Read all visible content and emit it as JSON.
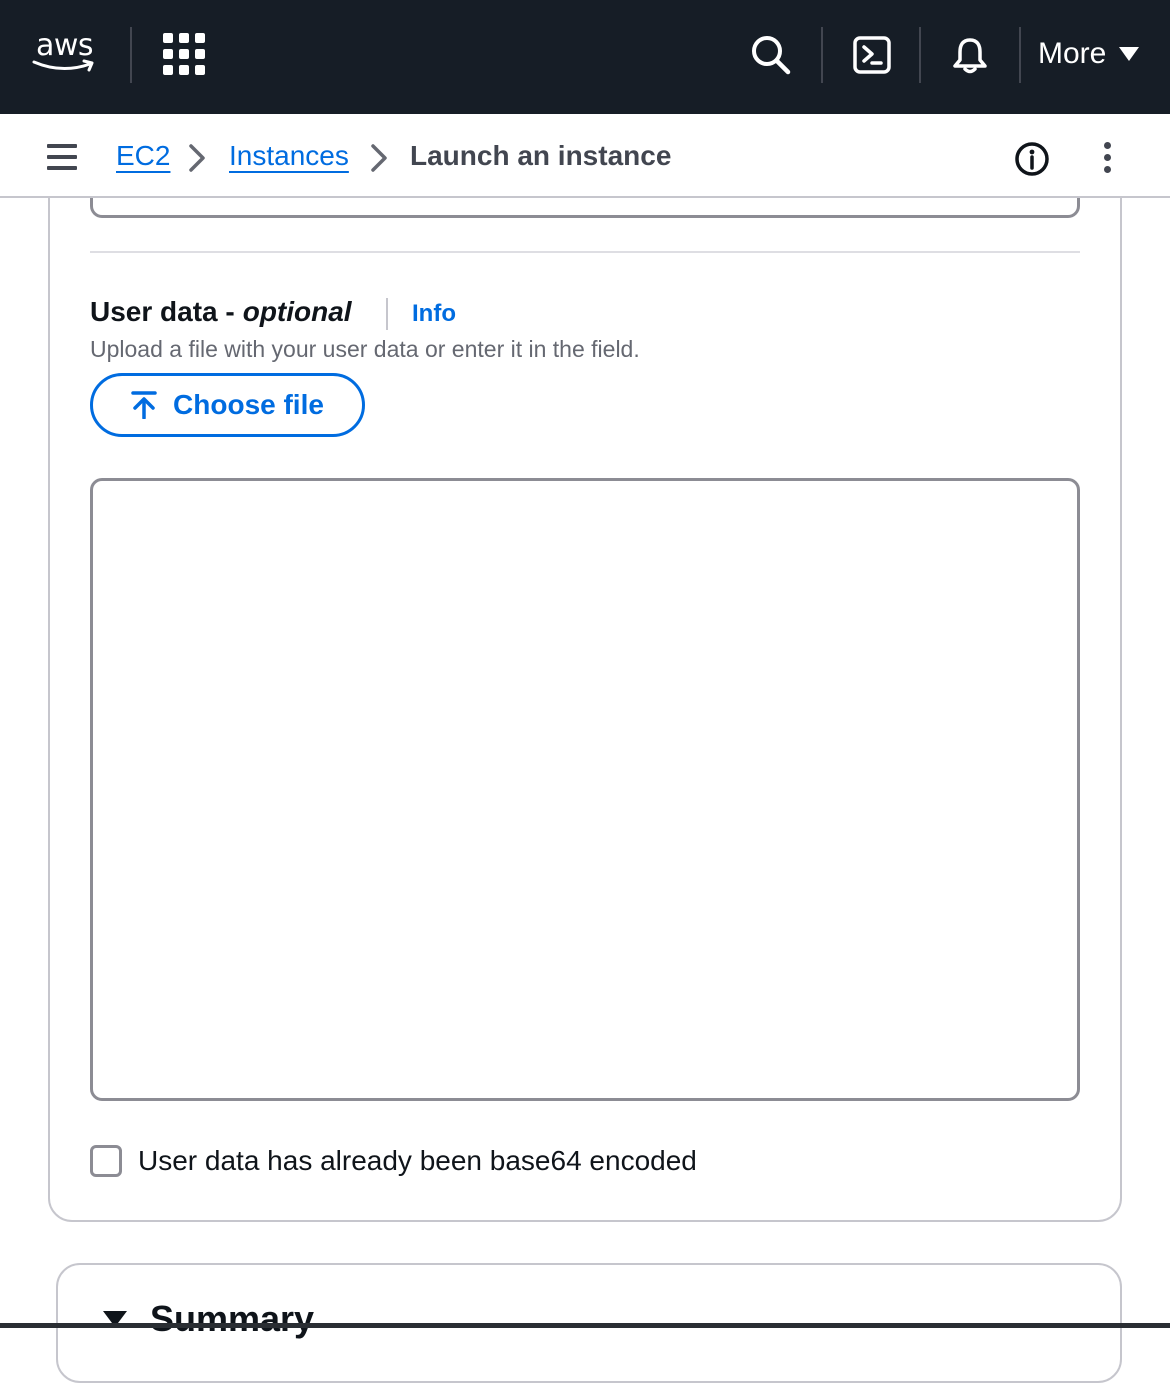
{
  "topbar": {
    "logo_text": "aws",
    "more_label": "More",
    "icons": [
      "apps-grid-icon",
      "search-icon",
      "cloudshell-icon",
      "bell-icon",
      "caret-down-icon"
    ]
  },
  "breadcrumb": {
    "items": [
      {
        "label": "EC2",
        "link": true
      },
      {
        "label": "Instances",
        "link": true
      },
      {
        "label": "Launch an instance",
        "link": false
      }
    ]
  },
  "user_data": {
    "label": "User data -",
    "label_optional": "optional",
    "info_link": "Info",
    "description": "Upload a file with your user data or enter it in the field.",
    "choose_file_label": "Choose file",
    "textarea_value": "",
    "checkbox_label": "User data has already been base64 encoded",
    "checkbox_checked": false
  },
  "summary": {
    "title": "Summary"
  },
  "colors": {
    "topbar_bg": "#161d26",
    "link": "#006ce0",
    "text": "#0f141a",
    "muted": "#656871",
    "border": "#8c8c94"
  }
}
